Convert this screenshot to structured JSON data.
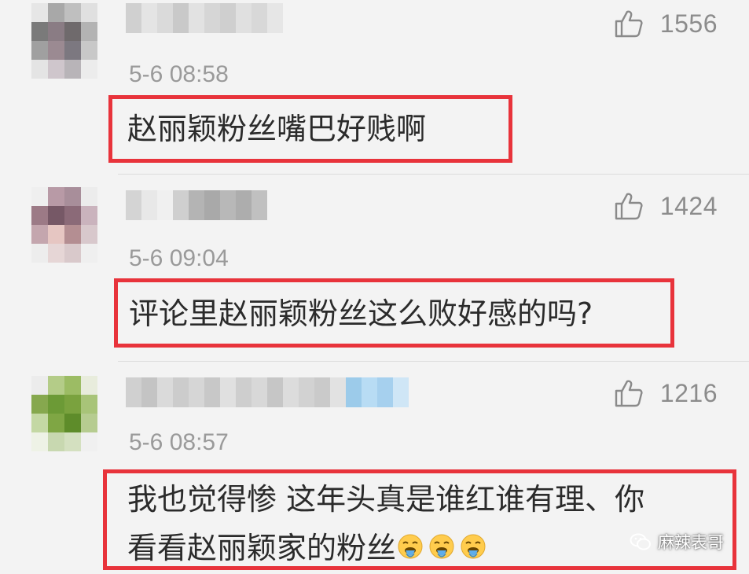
{
  "comments": [
    {
      "likes": "1556",
      "time": "5-6 08:58",
      "lines": [
        "赵丽颖粉丝嘴巴好贱啊"
      ],
      "avatar_colors": [
        "#e6e6e6",
        "#a8a8a8",
        "#bfbfbf",
        "#e0e0e0",
        "#7a7a7a",
        "#8a7c84",
        "#6f6a6c",
        "#b3b3b3",
        "#a0a0a0",
        "#9b8a92",
        "#7c7880",
        "#c8c8c8",
        "#e4e4e4",
        "#cfc6cc",
        "#b8b4b8",
        "#ececec"
      ],
      "username_colors": [
        "#d0d0d0",
        "#e4e4e4",
        "#dadada",
        "#c9c9c9",
        "#e2e2e2",
        "#d6d6d6",
        "#cfcfcf",
        "#e0e0e0",
        "#d8d8d8",
        "#e6e6e6"
      ]
    },
    {
      "likes": "1424",
      "time": "5-6 09:04",
      "lines": [
        "评论里赵丽颖粉丝这么败好感的吗?"
      ],
      "avatar_colors": [
        "#efefef",
        "#b89aa6",
        "#a88e9a",
        "#ececec",
        "#9c7a86",
        "#765866",
        "#8b6a78",
        "#cab3bd",
        "#c4a6ae",
        "#e6c6c2",
        "#b48e92",
        "#d8c8cc",
        "#ededed",
        "#e6d6d6",
        "#d9c9cb",
        "#efefef"
      ],
      "username_colors": [
        "#d4d4d4",
        "#e8e8e8",
        "#f0f0f0",
        "#cfcfcf",
        "#b4b4b4",
        "#a9a9a9",
        "#b8b8b8",
        "#adadad",
        "#c0c0c0"
      ]
    },
    {
      "likes": "1216",
      "time": "5-6 08:57",
      "lines": [
        "我也觉得惨 这年头真是谁红谁有理、你",
        "看看赵丽颖家的粉丝"
      ],
      "emoji_count": 3,
      "avatar_colors": [
        "#ececec",
        "#b4cc88",
        "#9cbc64",
        "#e8ecdc",
        "#86a84e",
        "#6c9a36",
        "#7aa23e",
        "#a8c478",
        "#c4d8a4",
        "#7fa644",
        "#5e8c2a",
        "#b6cc90",
        "#eef2e6",
        "#c8d8b0",
        "#d4e0c0",
        "#f0f0f0"
      ],
      "username_colors": [
        "#d0d0d0",
        "#c4c4c4",
        "#dadada",
        "#cccccc",
        "#d6d6d6",
        "#c8c8c8",
        "#e0e0e0",
        "#cecece",
        "#d8d8d8",
        "#c6c6c6",
        "#dcdcdc",
        "#d2d2d2",
        "#cacaca",
        "#e2e2e2",
        "#9ccbea",
        "#b8dcf4",
        "#a6d0ee",
        "#cfe6f6"
      ]
    }
  ],
  "watermark": {
    "text": "麻辣表哥",
    "icon": "wechat-icon"
  },
  "colors": {
    "highlight_border": "#e8333b",
    "background": "#f3f3f3",
    "meta_text": "#9a9a9a"
  }
}
